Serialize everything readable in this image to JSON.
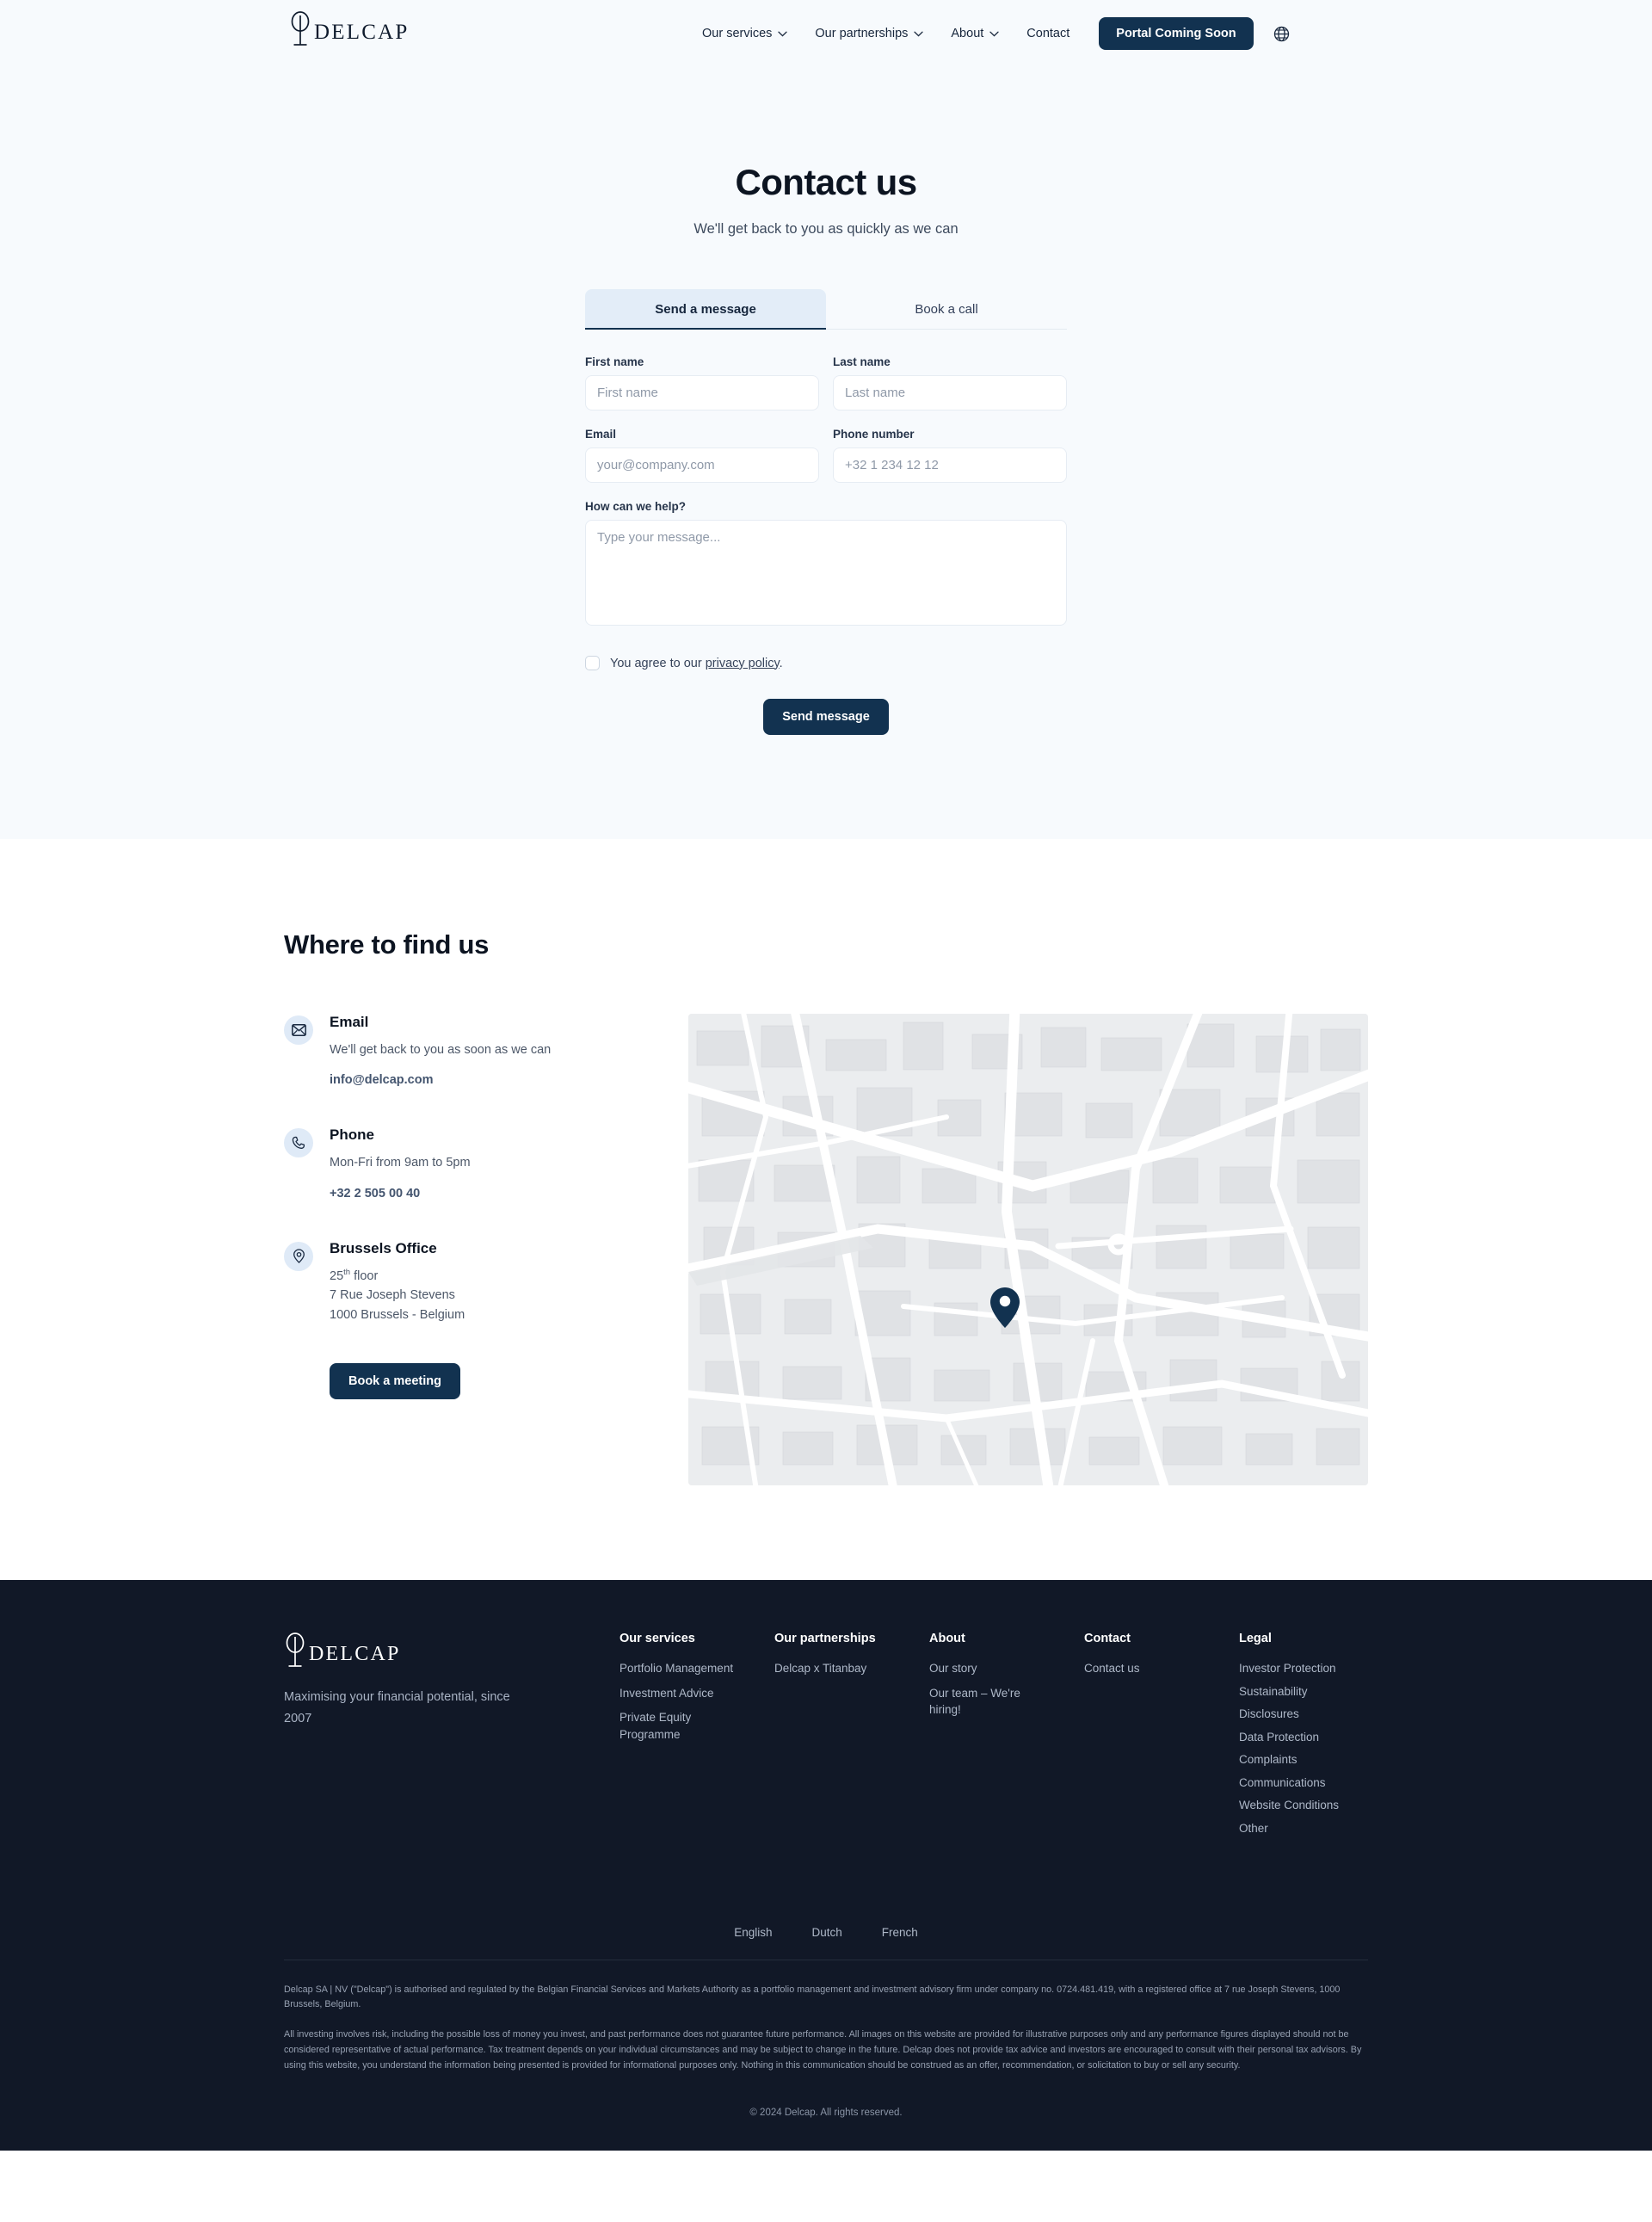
{
  "nav": {
    "logo_text": "DELCAP",
    "logo_icon": "delcap-tree-icon",
    "items": [
      {
        "label": "Our services",
        "has_chevron": true
      },
      {
        "label": "Our partnerships",
        "has_chevron": true
      },
      {
        "label": "About",
        "has_chevron": true
      },
      {
        "label": "Contact",
        "has_chevron": false
      }
    ],
    "cta_label": "Portal Coming Soon",
    "language_icon": "globe-icon"
  },
  "hero": {
    "title": "Contact us",
    "subtitle": "We'll get back to you as quickly as we can"
  },
  "form": {
    "tabs": [
      {
        "label": "Send a message",
        "active": true
      },
      {
        "label": "Book a call",
        "active": false
      }
    ],
    "fields": {
      "first_name": {
        "label": "First name",
        "placeholder": "First name",
        "value": ""
      },
      "last_name": {
        "label": "Last name",
        "placeholder": "Last name",
        "value": ""
      },
      "email": {
        "label": "Email",
        "placeholder": "your@company.com",
        "value": ""
      },
      "phone": {
        "label": "Phone number",
        "placeholder": "+32 1 234 12 12",
        "value": ""
      },
      "message": {
        "label": "How can we help?",
        "placeholder": "Type your message...",
        "value": ""
      }
    },
    "agree_prefix": "You agree to our ",
    "agree_link": "privacy policy",
    "agree_suffix": ".",
    "submit_label": "Send message"
  },
  "find_us": {
    "title": "Where to find us",
    "blocks": [
      {
        "icon": "envelope-icon",
        "title": "Email",
        "description": "We'll get back to you as soon as we can",
        "link": "info@delcap.com"
      },
      {
        "icon": "phone-icon",
        "title": "Phone",
        "description": "Mon-Fri from 9am to 5pm",
        "link": "+32 2 505 00 40"
      },
      {
        "icon": "map-pin-icon",
        "title": "Brussels Office",
        "address_line1_num": "25",
        "address_line1_sup": "th",
        "address_line1_rest": " floor",
        "address_line2": "7 Rue Joseph Stevens",
        "address_line3": "1000 Brussels - Belgium"
      }
    ],
    "book_button": "Book a meeting",
    "map_marker_icon": "map-pin-marker"
  },
  "footer": {
    "logo_text": "DELCAP",
    "tagline": "Maximising your financial potential, since 2007",
    "columns": [
      {
        "heading": "Our services",
        "links": [
          "Portfolio Management",
          "Investment Advice",
          "Private Equity Programme"
        ]
      },
      {
        "heading": "Our partnerships",
        "links": [
          "Delcap x Titanbay"
        ]
      },
      {
        "heading": "About",
        "links": [
          "Our story",
          "Our team – We're hiring!"
        ]
      },
      {
        "heading": "Contact",
        "links": [
          "Contact us"
        ]
      },
      {
        "heading": "Legal",
        "links": [
          "Investor Protection",
          "Sustainability",
          "Disclosures",
          "Data Protection",
          "Complaints",
          "Communications",
          "Website Conditions",
          "Other"
        ]
      }
    ],
    "languages": [
      "English",
      "Dutch",
      "French"
    ],
    "legal_paragraph_1": "Delcap SA | NV (\"Delcap\") is authorised and regulated by the Belgian Financial Services and Markets Authority as a portfolio management and investment advisory firm under company no. 0724.481.419, with a registered office at 7 rue Joseph Stevens, 1000 Brussels, Belgium.",
    "legal_paragraph_2": "All investing involves risk, including the possible loss of money you invest, and past performance does not guarantee future performance. All images on this website are provided for illustrative purposes only and any performance figures displayed should not be considered representative of actual performance. Tax treatment depends on your individual circumstances and may be subject to change in the future. Delcap does not provide tax advice and investors are encouraged to consult with their personal tax advisors. By using this website, you understand the information being presented is provided for informational purposes only. Nothing in this communication should be construed as an offer, recommendation, or solicitation to buy or sell any security.",
    "copyright": "© 2024 Delcap. All rights reserved."
  },
  "colors": {
    "brand_dark": "#123250",
    "hero_bg": "#f7fafd",
    "footer_bg": "#111827",
    "tab_active_bg": "#e3edf8",
    "icon_circle_bg": "#dfeaf7"
  }
}
